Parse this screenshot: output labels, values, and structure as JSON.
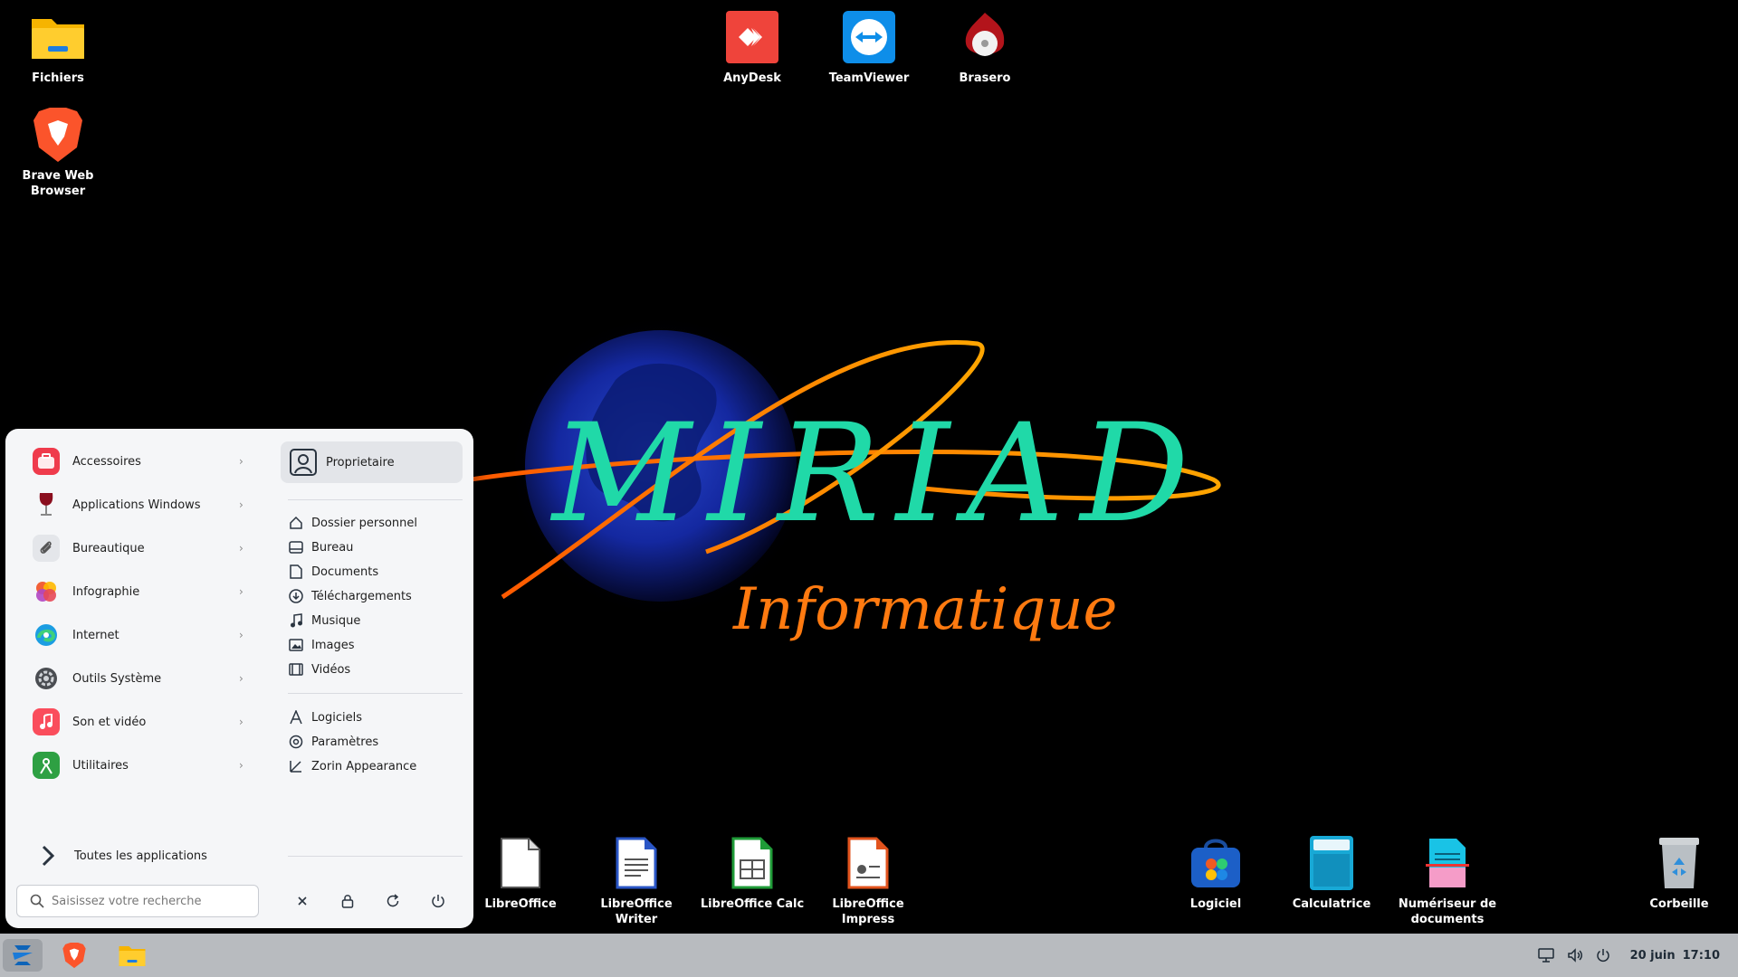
{
  "wallpaper": {
    "title": "MIRIAD",
    "subtitle": "Informatique"
  },
  "desktop": {
    "top_left": [
      {
        "label": "Fichiers",
        "icon": "folder-icon"
      },
      {
        "label": "Brave Web Browser",
        "icon": "brave-icon"
      }
    ],
    "top_center": [
      {
        "label": "AnyDesk",
        "icon": "anydesk-icon"
      },
      {
        "label": "TeamViewer",
        "icon": "teamviewer-icon"
      },
      {
        "label": "Brasero",
        "icon": "brasero-icon"
      }
    ],
    "bottom": [
      {
        "label": "LibreOffice",
        "icon": "libreoffice-icon"
      },
      {
        "label": "LibreOffice Writer",
        "icon": "writer-icon"
      },
      {
        "label": "LibreOffice Calc",
        "icon": "calc-icon"
      },
      {
        "label": "LibreOffice Impress",
        "icon": "impress-icon"
      },
      {
        "label": "Logiciel",
        "icon": "software-store-icon"
      },
      {
        "label": "Calculatrice",
        "icon": "calculator-icon"
      },
      {
        "label": "Numériseur de documents",
        "icon": "scanner-icon"
      },
      {
        "label": "Corbeille",
        "icon": "trash-icon"
      }
    ]
  },
  "start_menu": {
    "categories": [
      {
        "label": "Accessoires",
        "icon": "accessories-icon"
      },
      {
        "label": "Applications Windows",
        "icon": "wine-icon"
      },
      {
        "label": "Bureautique",
        "icon": "paperclip-icon"
      },
      {
        "label": "Infographie",
        "icon": "graphics-icon"
      },
      {
        "label": "Internet",
        "icon": "edge-icon"
      },
      {
        "label": "Outils Système",
        "icon": "system-tools-icon"
      },
      {
        "label": "Son et vidéo",
        "icon": "music-icon"
      },
      {
        "label": "Utilitaires",
        "icon": "utilities-icon"
      }
    ],
    "all_apps_label": "Toutes les applications",
    "search_placeholder": "Saisissez votre recherche",
    "user_label": "Proprietaire",
    "places": [
      {
        "label": "Dossier personnel",
        "icon": "home-icon"
      },
      {
        "label": "Bureau",
        "icon": "desktop-icon"
      },
      {
        "label": "Documents",
        "icon": "document-icon"
      },
      {
        "label": "Téléchargements",
        "icon": "download-icon"
      },
      {
        "label": "Musique",
        "icon": "music-note-icon"
      },
      {
        "label": "Images",
        "icon": "image-icon"
      },
      {
        "label": "Vidéos",
        "icon": "film-icon"
      }
    ],
    "system": [
      {
        "label": "Logiciels",
        "icon": "store-icon"
      },
      {
        "label": "Paramètres",
        "icon": "settings-icon"
      },
      {
        "label": "Zorin Appearance",
        "icon": "appearance-icon"
      }
    ]
  },
  "taskbar": {
    "date": "20 juin",
    "time": "17:10"
  }
}
